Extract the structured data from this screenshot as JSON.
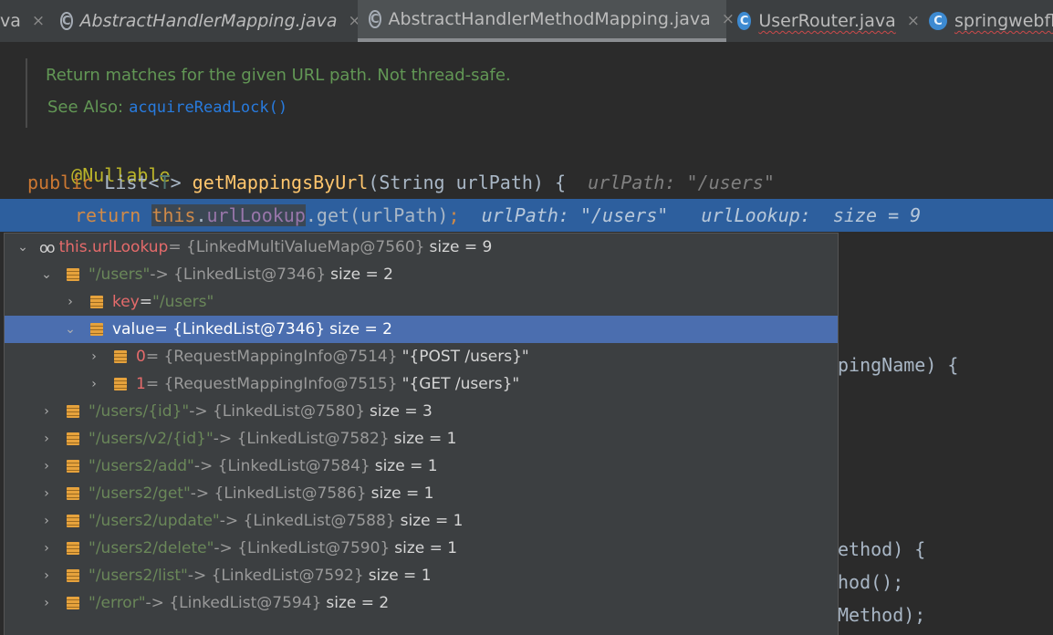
{
  "tabs": [
    {
      "label": "va",
      "close": "×",
      "icon": "",
      "style": "plain"
    },
    {
      "label": "AbstractHandlerMapping.java",
      "close": "×",
      "icon": "C",
      "style": "italic"
    },
    {
      "label": "AbstractHandlerMethodMapping.java",
      "close": "×",
      "icon": "C",
      "style": "active"
    },
    {
      "label": "UserRouter.java",
      "close": "×",
      "icon": "C",
      "style": "wavy"
    },
    {
      "label": "springwebflu",
      "close": "",
      "icon": "C",
      "style": "wavy"
    }
  ],
  "doc": {
    "text": "Return matches for the given URL path. Not thread-safe.",
    "see_also_label": "See Also:",
    "see_also_link": "acquireReadLock()"
  },
  "code": {
    "annotation": "@Nullable",
    "sig_public": "public",
    "sig_list": "List<",
    "sig_t": "T",
    "sig_gt": ">",
    "sig_method": "getMappingsByUrl",
    "sig_params": "(String urlPath) {",
    "sig_hint": "urlPath: \"/users\"",
    "ret_kw": "return",
    "ret_this": "this",
    "ret_dot": ".",
    "ret_field": "urlLookup",
    "ret_rest": ".get(urlPath)",
    "ret_semi": ";",
    "ret_hint1": "urlPath: \"/users\"",
    "ret_hint2": "urlLookup:  size = 9"
  },
  "background_fragments": {
    "line1": "pingName) {",
    "line2": "ethod) {",
    "line3": "hod();",
    "line4": "Method);"
  },
  "debug": {
    "root": {
      "name": "this.urlLookup",
      "value": " = {LinkedMultiValueMap@7560}",
      "size": "size = 9"
    },
    "entry_users": {
      "key": "\"/users\"",
      "value": " -> {LinkedList@7346}",
      "size": "size = 2"
    },
    "key_row": {
      "name": "key",
      "eq": " = ",
      "value": "\"/users\""
    },
    "value_row": {
      "name": "value",
      "value": " = {LinkedList@7346}",
      "size": "size = 2"
    },
    "items": [
      {
        "index": "0",
        "value": " = {RequestMappingInfo@7514}",
        "desc": "\"{POST /users}\""
      },
      {
        "index": "1",
        "value": " = {RequestMappingInfo@7515}",
        "desc": "\"{GET /users}\""
      }
    ],
    "entries": [
      {
        "key": "\"/users/{id}\"",
        "value": " -> {LinkedList@7580}",
        "size": "size = 3"
      },
      {
        "key": "\"/users/v2/{id}\"",
        "value": " -> {LinkedList@7582}",
        "size": "size = 1"
      },
      {
        "key": "\"/users2/add\"",
        "value": " -> {LinkedList@7584}",
        "size": "size = 1"
      },
      {
        "key": "\"/users2/get\"",
        "value": " -> {LinkedList@7586}",
        "size": "size = 1"
      },
      {
        "key": "\"/users2/update\"",
        "value": " -> {LinkedList@7588}",
        "size": "size = 1"
      },
      {
        "key": "\"/users2/delete\"",
        "value": " -> {LinkedList@7590}",
        "size": "size = 1"
      },
      {
        "key": "\"/users2/list\"",
        "value": " -> {LinkedList@7592}",
        "size": "size = 1"
      },
      {
        "key": "\"/error\"",
        "value": " -> {LinkedList@7594}",
        "size": "size = 2"
      }
    ],
    "arrow_expanded": "⌄",
    "arrow_collapsed": "›",
    "glasses": "oo"
  }
}
